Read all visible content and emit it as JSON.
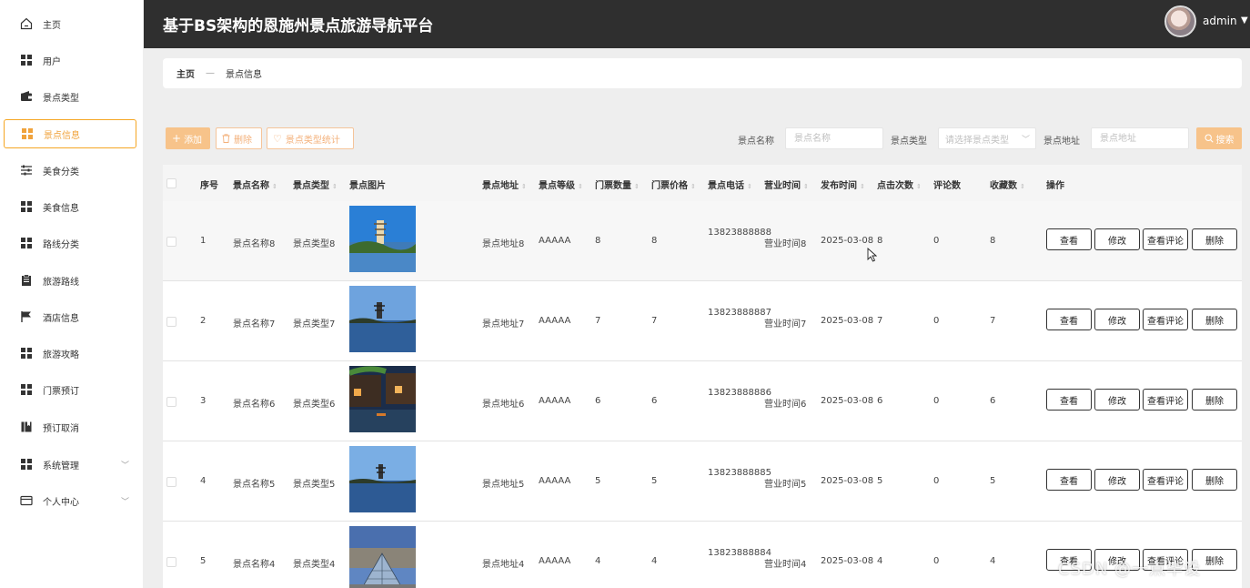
{
  "sidebar": {
    "items": [
      {
        "label": "主页",
        "icon": "home-icon"
      },
      {
        "label": "用户",
        "icon": "grid-icon"
      },
      {
        "label": "景点类型",
        "icon": "wallet-icon"
      },
      {
        "label": "景点信息",
        "icon": "grid-icon",
        "active": true
      },
      {
        "label": "美食分类",
        "icon": "sliders-icon"
      },
      {
        "label": "美食信息",
        "icon": "grid-icon"
      },
      {
        "label": "路线分类",
        "icon": "grid-icon"
      },
      {
        "label": "旅游路线",
        "icon": "clipboard-icon"
      },
      {
        "label": "酒店信息",
        "icon": "flag-icon"
      },
      {
        "label": "旅游攻略",
        "icon": "grid-icon"
      },
      {
        "label": "门票预订",
        "icon": "grid-icon"
      },
      {
        "label": "预订取消",
        "icon": "book-icon"
      },
      {
        "label": "系统管理",
        "icon": "grid-icon",
        "expandable": true
      },
      {
        "label": "个人中心",
        "icon": "card-icon",
        "expandable": true
      }
    ]
  },
  "header": {
    "title": "基于BS架构的恩施州景点旅游导航平台",
    "user": "admin"
  },
  "breadcrumb": {
    "home": "主页",
    "separator": "—",
    "current": "景点信息"
  },
  "toolbar": {
    "add_label": "添加",
    "delete_label": "删除",
    "stats_label": "景点类型统计",
    "name_label": "景点名称",
    "name_placeholder": "景点名称",
    "type_label": "景点类型",
    "type_placeholder": "请选择景点类型",
    "address_label": "景点地址",
    "address_placeholder": "景点地址",
    "search_label": "搜索"
  },
  "table": {
    "columns": [
      "序号",
      "景点名称",
      "景点类型",
      "景点图片",
      "景点地址",
      "景点等级",
      "门票数量",
      "门票价格",
      "景点电话",
      "营业时间",
      "发布时间",
      "点击次数",
      "评论数",
      "收藏数",
      "操作"
    ],
    "actions": {
      "view": "查看",
      "edit": "修改",
      "comments": "查看评论",
      "delete": "删除"
    },
    "rows": [
      {
        "no": "1",
        "name": "景点名称8",
        "type": "景点类型8",
        "address": "景点地址8",
        "level": "AAAAA",
        "qty": "8",
        "price": "8",
        "phone": "13823888888",
        "hours": "营业时间8",
        "date": "2025-03-08",
        "clicks": "8",
        "comments": "0",
        "favs": "8"
      },
      {
        "no": "2",
        "name": "景点名称7",
        "type": "景点类型7",
        "address": "景点地址7",
        "level": "AAAAA",
        "qty": "7",
        "price": "7",
        "phone": "13823888887",
        "hours": "营业时间7",
        "date": "2025-03-08",
        "clicks": "7",
        "comments": "0",
        "favs": "7"
      },
      {
        "no": "3",
        "name": "景点名称6",
        "type": "景点类型6",
        "address": "景点地址6",
        "level": "AAAAA",
        "qty": "6",
        "price": "6",
        "phone": "13823888886",
        "hours": "营业时间6",
        "date": "2025-03-08",
        "clicks": "6",
        "comments": "0",
        "favs": "6"
      },
      {
        "no": "4",
        "name": "景点名称5",
        "type": "景点类型5",
        "address": "景点地址5",
        "level": "AAAAA",
        "qty": "5",
        "price": "5",
        "phone": "13823888885",
        "hours": "营业时间5",
        "date": "2025-03-08",
        "clicks": "5",
        "comments": "0",
        "favs": "5"
      },
      {
        "no": "5",
        "name": "景点名称4",
        "type": "景点类型4",
        "address": "景点地址4",
        "level": "AAAAA",
        "qty": "4",
        "price": "4",
        "phone": "13823888884",
        "hours": "营业时间4",
        "date": "2025-03-08",
        "clicks": "4",
        "comments": "0",
        "favs": "4"
      }
    ]
  },
  "watermark": "CSDN @一点毕设",
  "colors": {
    "accent": "#f0a33c",
    "accent_light": "#f7c38a",
    "header_bg": "#2f2f2f"
  }
}
